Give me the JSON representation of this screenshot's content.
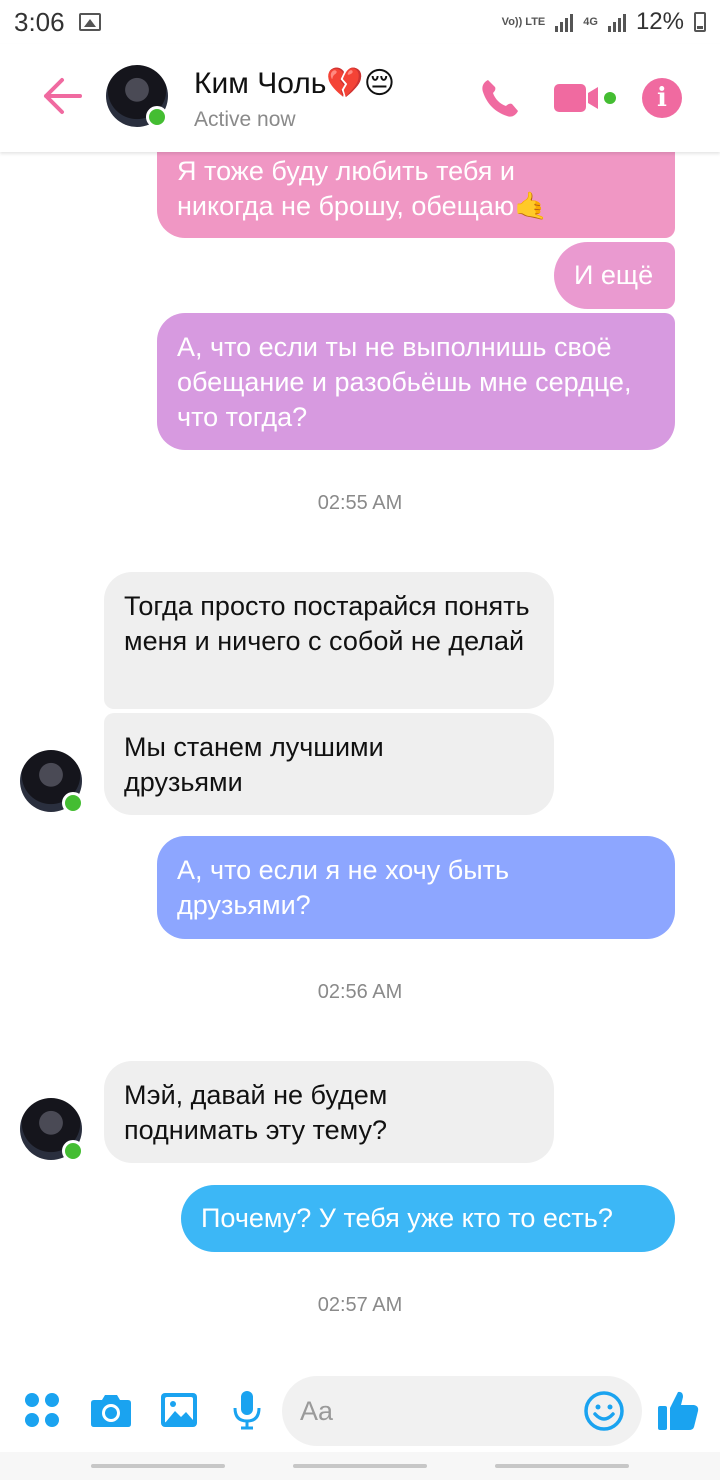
{
  "status_bar": {
    "time": "3:06",
    "volte": "Vo)) LTE",
    "network": "4G",
    "battery": "12%"
  },
  "header": {
    "contact_name": "Ким Чоль💔😔",
    "status": "Active now"
  },
  "colors": {
    "accent_pink": "#f06aa0",
    "accent_blue": "#1aa3f0",
    "online": "#44bd32"
  },
  "messages": [
    {
      "direction": "out",
      "text": "Я тоже буду любить тебя и никогда не брошу, обещаю🤙"
    },
    {
      "direction": "out",
      "text": "И ещё"
    },
    {
      "direction": "out",
      "text": "А, что если ты не выполнишь своё обещание и разобьёшь мне сердце, что тогда?"
    },
    {
      "type": "timestamp",
      "text": "02:55 AM"
    },
    {
      "direction": "in",
      "text": "Тогда просто постарайся понять меня и ничего с собой не делай"
    },
    {
      "direction": "in",
      "text": "Мы станем лучшими друзьями"
    },
    {
      "direction": "out",
      "text": "А, что если я не хочу быть друзьями?"
    },
    {
      "type": "timestamp",
      "text": "02:56 AM"
    },
    {
      "direction": "in",
      "text": "Мэй, давай не будем поднимать эту тему?"
    },
    {
      "direction": "out",
      "text": "Почему? У тебя уже кто то есть?"
    },
    {
      "type": "timestamp",
      "text": "02:57 AM"
    }
  ],
  "composer": {
    "placeholder": "Aa"
  }
}
